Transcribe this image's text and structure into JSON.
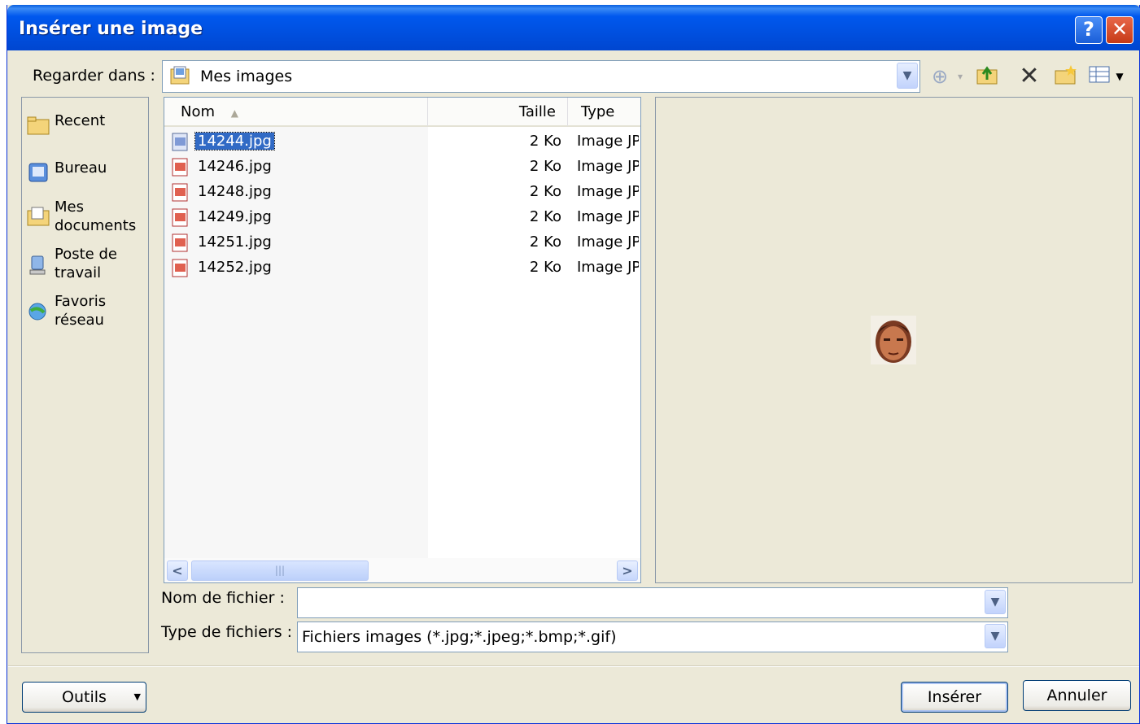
{
  "window": {
    "title": "Insérer une image",
    "help_label": "?",
    "close_label": "✕"
  },
  "lookin": {
    "label": "Regarder dans :",
    "value": "Mes images"
  },
  "places": [
    {
      "line1": "Recent",
      "line2": ""
    },
    {
      "line1": "Bureau",
      "line2": ""
    },
    {
      "line1": "Mes",
      "line2": "documents"
    },
    {
      "line1": "Poste de",
      "line2": "travail"
    },
    {
      "line1": "Favoris",
      "line2": "réseau"
    }
  ],
  "columns": {
    "name": "Nom",
    "size": "Taille",
    "type": "Type"
  },
  "files": [
    {
      "name": "14244.jpg",
      "size": "2 Ko",
      "type": "Image JPEG"
    },
    {
      "name": "14246.jpg",
      "size": "2 Ko",
      "type": "Image JPEG"
    },
    {
      "name": "14248.jpg",
      "size": "2 Ko",
      "type": "Image JPEG"
    },
    {
      "name": "14249.jpg",
      "size": "2 Ko",
      "type": "Image JPEG"
    },
    {
      "name": "14251.jpg",
      "size": "2 Ko",
      "type": "Image JPEG"
    },
    {
      "name": "14252.jpg",
      "size": "2 Ko",
      "type": "Image JPEG"
    }
  ],
  "selected_file": "14244.jpg",
  "filename": {
    "label": "Nom de fichier :",
    "value": ""
  },
  "filetype": {
    "label": "Type de fichiers :",
    "value": "Fichiers images (*.jpg;*.jpeg;*.bmp;*.gif)"
  },
  "buttons": {
    "tools": "Outils",
    "insert": "Insérer",
    "cancel": "Annuler"
  },
  "colors": {
    "title_bar": "#0054e3",
    "selection": "#316ac5",
    "dialog_bg": "#ece9d8"
  }
}
